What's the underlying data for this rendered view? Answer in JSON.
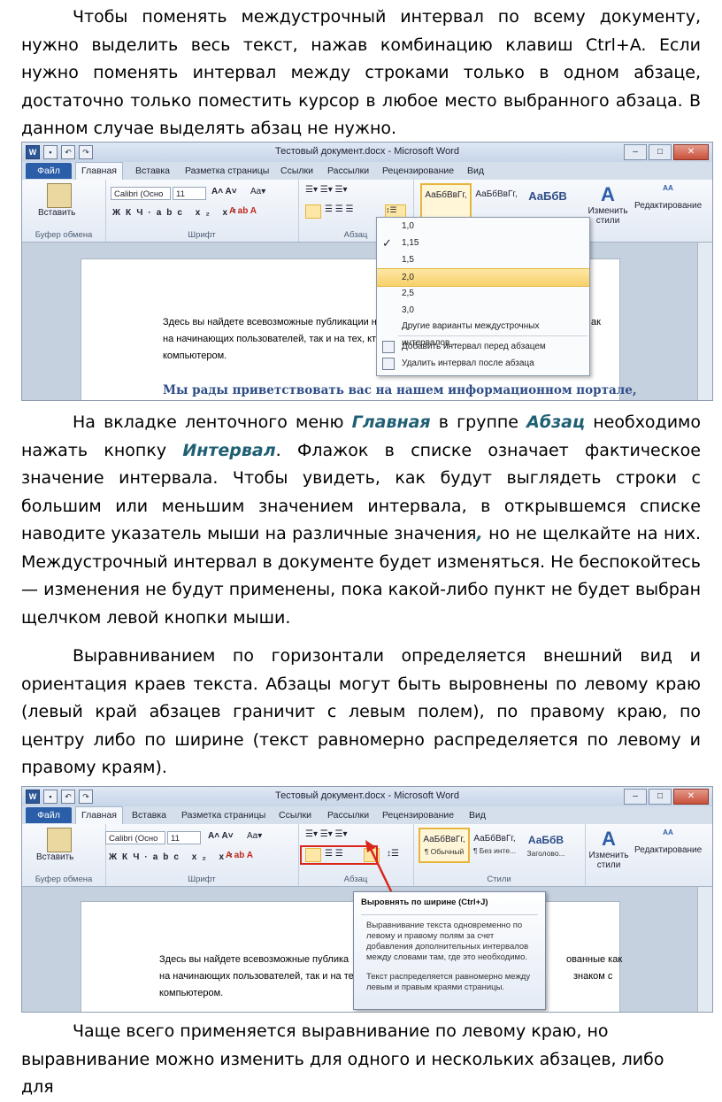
{
  "para1": {
    "text": "Чтобы поменять междустрочный интервал по всему документу, нужно выделить весь текст, нажав комбинацию клавиш Ctrl+A. Если нужно поменять интервал между строками только в одном абзаце, достаточно только поместить курсор в любое место выбранного абзаца. В данном случае выделять абзац не нужно."
  },
  "para2": {
    "t1": "На вкладке ленточного меню ",
    "h1": "Главная",
    "t2": " в группе ",
    "h2": "Абзац",
    "t3": " необходимо нажать кнопку ",
    "h3": "Интервал",
    "t4": ". Флажок в списке означает фактическое значение интервала. Чтобы увидеть, как будут выглядеть строки с большим или меньшим значением интервала, в открывшемся списке наводите указатель мыши на различные значения",
    "h4": ",",
    "t5": " но не щелкайте на них. Междустрочный интервал в документе будет изменяться. Не беспокойтесь — изменения не будут применены, пока какой-либо пункт не будет выбран щелчком левой кнопки мыши."
  },
  "para3": {
    "text": "Выравниванием по горизонтали определяется внешний вид и ориентация краев текста. Абзацы могут быть выровнены по левому краю (левый край абзацев граничит с левым полем), по правому краю, по центру либо по ширине (текст равномерно распределяется по левому и правому краям)."
  },
  "para4": {
    "text": "Чаще всего применяется выравнивание по левому краю, но выравнивание можно изменить для одного и нескольких абзацев, либо для"
  },
  "word": {
    "window_title": "Тестовый документ.docx - Microsoft Word",
    "tabs": [
      "Файл",
      "Главная",
      "Вставка",
      "Разметка страницы",
      "Ссылки",
      "Рассылки",
      "Рецензирование",
      "Вид"
    ],
    "paste_label": "Вставить",
    "clipboard_group": "Буфер обмена",
    "font_group": "Шрифт",
    "paragraph_group": "Абзац",
    "styles_group": "Стили",
    "font_name": "Calibri (Осно",
    "font_size": "11",
    "style1": "АаБбВвГг,",
    "style1_name": "¶ Обычный",
    "style2": "АаБбВвГг,",
    "style2_name": "¶ Без инте...",
    "style3": "АаБбВ",
    "style3_name": "Заголово...",
    "change_styles": "Изменить стили",
    "editing": "Редактирование",
    "doc_line1": "Здесь вы найдете всевозможные публикации н",
    "doc_line2": "на начинающих пользователей, так и на тех, кто",
    "doc_line3": "компьютером.",
    "doc_line1_tail": "ак",
    "doc_heading": "Мы рады приветствовать вас на нашем информационном портале,",
    "doc2_line1a": "Здесь вы найдете всевозможные публика",
    "doc2_line1b": "ованные как",
    "doc2_line2a": "на начинающих пользователей, так и на те",
    "doc2_line2b": "знаком с",
    "doc2_line3": "компьютером.",
    "spacing_menu": [
      "1,0",
      "1,15",
      "1,5",
      "2,0",
      "2,5",
      "3,0"
    ],
    "spacing_checked": "1,15",
    "spacing_hover": "2,0",
    "spacing_other": "Другие варианты междустрочных интервалов...",
    "spacing_before": "Добавить интервал перед абзацем",
    "spacing_after": "Удалить интервал после абзаца",
    "tooltip_title": "Выровнять по ширине (Ctrl+J)",
    "tooltip_p1": "Выравнивание текста одновременно по левому и правому полям за счет добавления дополнительных интервалов между словами там, где это необходимо.",
    "tooltip_p2": "Текст распределяется равномерно между левым и правым краями страницы."
  }
}
